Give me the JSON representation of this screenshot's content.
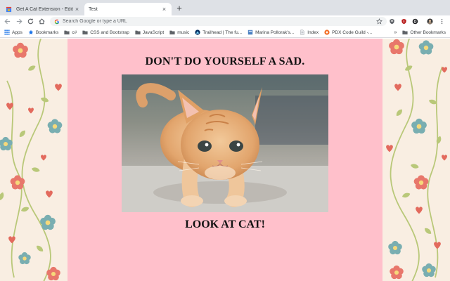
{
  "browser": {
    "tabs": [
      {
        "title": "Get A Cat Extension - Edit item",
        "active": false
      },
      {
        "title": "Test",
        "active": true
      }
    ],
    "omnibox": {
      "placeholder": "Search Google or type a URL"
    },
    "bookmarks": [
      {
        "label": "Apps",
        "icon": "apps-grid-icon"
      },
      {
        "label": "Bookmarks",
        "icon": "star-icon"
      },
      {
        "label": "c#",
        "icon": "folder-icon"
      },
      {
        "label": "CSS and Bootstrap",
        "icon": "folder-icon"
      },
      {
        "label": "JavaScript",
        "icon": "folder-icon"
      },
      {
        "label": "music",
        "icon": "folder-icon"
      },
      {
        "label": "Trailhead | The fu...",
        "icon": "trailhead-icon"
      },
      {
        "label": "Marina Pollorak's...",
        "icon": "page-icon"
      },
      {
        "label": "Index",
        "icon": "doc-icon"
      },
      {
        "label": "PDX Code Guild -...",
        "icon": "pdx-icon"
      }
    ],
    "bookmarks_overflow": "»",
    "other_bookmarks": "Other Bookmarks"
  },
  "page": {
    "headline": "DON'T DO YOURSELF A SAD.",
    "caption": "LOOK AT CAT!",
    "colors": {
      "content_bg": "#ffc0cb",
      "wallpaper_bg": "#f9eee2"
    }
  }
}
